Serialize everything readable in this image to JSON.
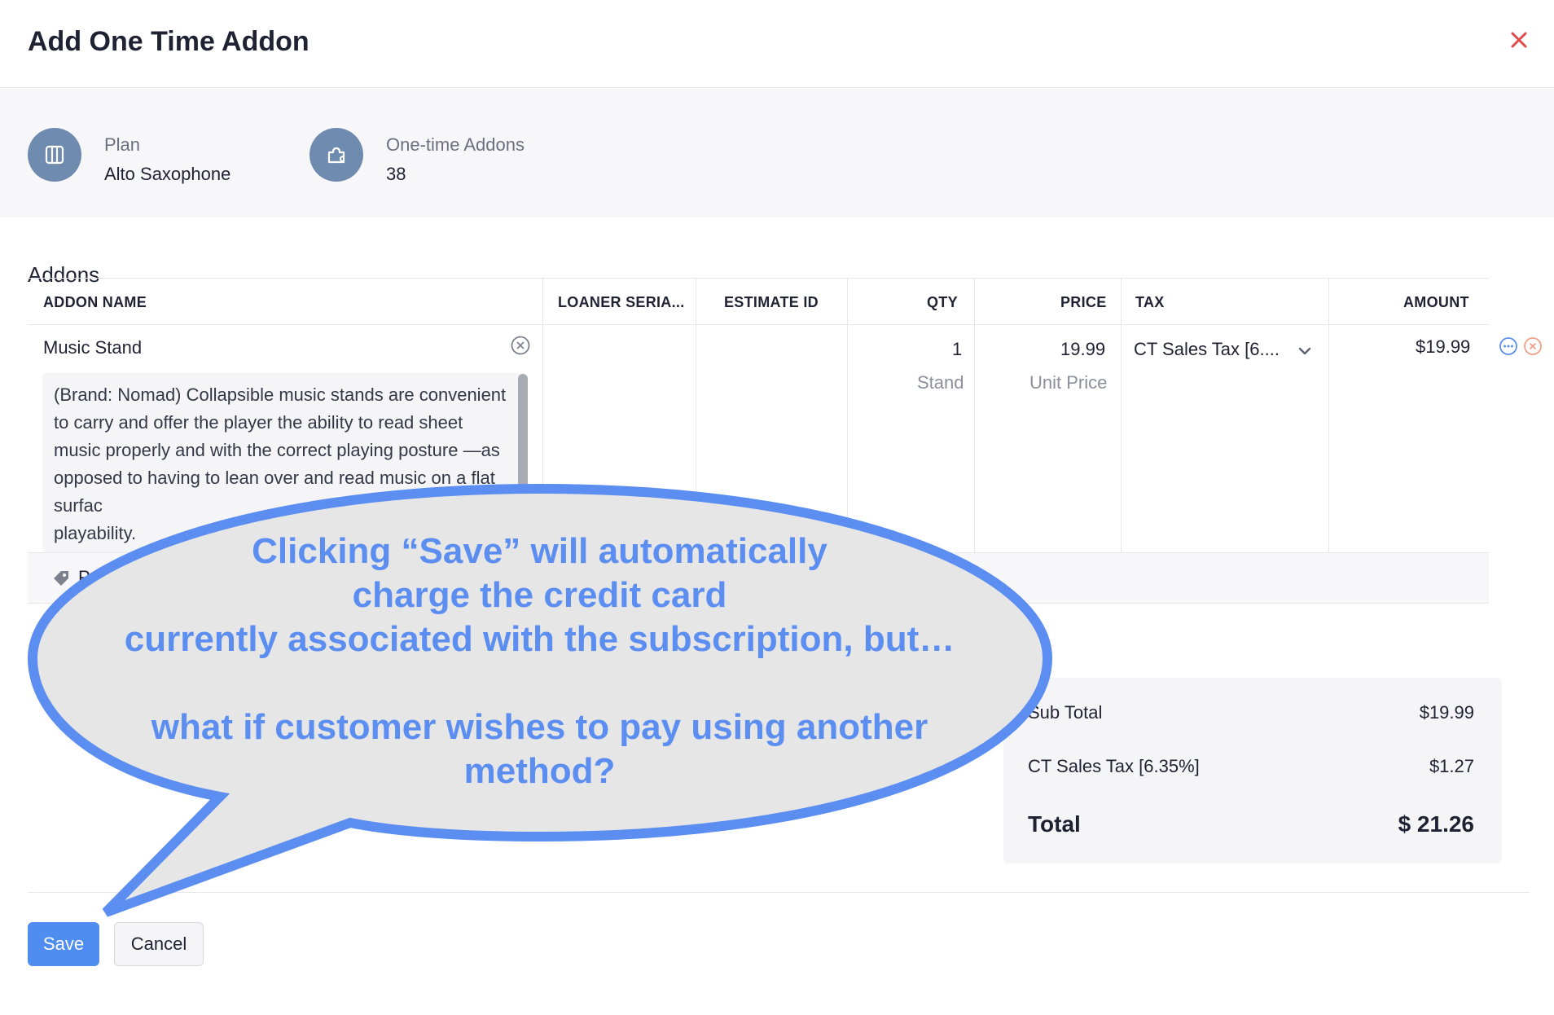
{
  "dialog": {
    "title": "Add One Time Addon",
    "close_icon": "close-icon",
    "close_color": "#e04a4a"
  },
  "info": {
    "plan_label": "Plan",
    "plan_value": "Alto Saxophone",
    "plan_icon": "book-icon",
    "addons_label": "One-time Addons",
    "addons_value": "38",
    "addons_icon": "puzzle-icon"
  },
  "addons": {
    "section_title": "Addons",
    "columns": [
      "ADDON NAME",
      "LOANER SERIA...",
      "ESTIMATE ID",
      "QTY",
      "PRICE",
      "TAX",
      "AMOUNT"
    ],
    "row": {
      "name": "Music Stand",
      "description": "(Brand: Nomad) Collapsible music stands are convenient to carry and offer the player the ability to read sheet music properly and with the correct playing posture —as opposed to having to lean over and read music on a flat surfac",
      "description_tail": "playability.",
      "qty": "1",
      "qty_unit": "Stand",
      "price": "19.99",
      "price_unit": "Unit Price",
      "tax": "CT Sales Tax [6....",
      "amount": "$19.99"
    },
    "tag_row_text": "P"
  },
  "totals": {
    "subtotal_label": "Sub Total",
    "subtotal_value": "$19.99",
    "tax_label": "CT Sales Tax [6.35%]",
    "tax_value": "$1.27",
    "total_label": "Total",
    "total_value": "$ 21.26"
  },
  "buttons": {
    "save": "Save",
    "cancel": "Cancel",
    "accent": "#4f8df0"
  },
  "callout": {
    "line1": "Clicking “Save” will automatically",
    "line2": "charge the credit card",
    "line3": "currently associated with the subscription, but…",
    "line4": "what if customer wishes to pay using another",
    "line5": "method?",
    "text_color": "#5b8ef0",
    "border_color": "#5b8ef0",
    "fill_color": "#e6e6e6"
  }
}
